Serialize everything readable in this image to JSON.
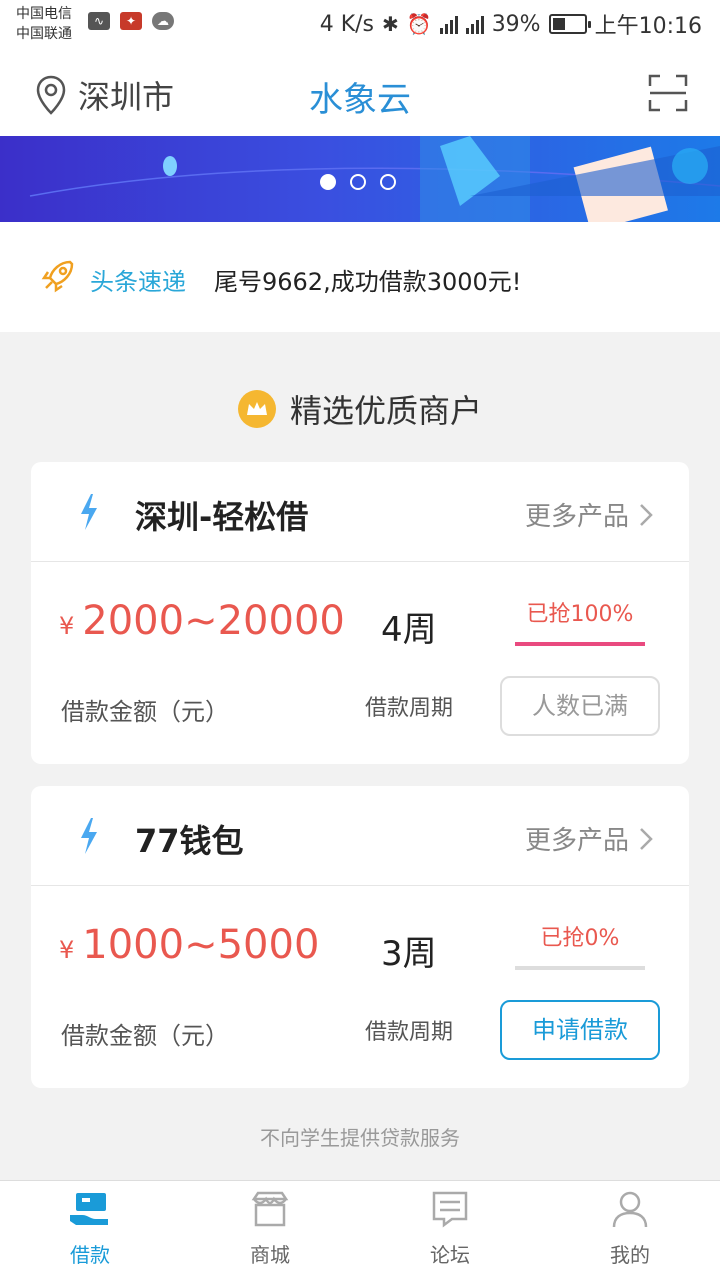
{
  "status_bar": {
    "carrier1": "中国电信",
    "carrier2": "中国联通",
    "speed": "4 K/s",
    "net1": "2G",
    "net2": "4G",
    "battery": "39%",
    "time": "上午10:16"
  },
  "header": {
    "city": "深圳市",
    "title": "水象云"
  },
  "banner": {
    "dots": 3,
    "active_dot": 0
  },
  "news": {
    "tag": "头条速递",
    "message": "尾号9662,成功借款3000元!"
  },
  "section": {
    "title": "精选优质商户"
  },
  "merchants": [
    {
      "name": "深圳-轻松借",
      "more": "更多产品",
      "currency": "¥",
      "amount": "2000~20000",
      "amount_label": "借款金额（元）",
      "period": "4周",
      "period_label": "借款周期",
      "grab": "已抢100%",
      "grab_fraction": 1.0,
      "button": "人数已满",
      "button_enabled": false
    },
    {
      "name": "77钱包",
      "more": "更多产品",
      "currency": "¥",
      "amount": "1000~5000",
      "amount_label": "借款金额（元）",
      "period": "3周",
      "period_label": "借款周期",
      "grab": "已抢0%",
      "grab_fraction": 0.0,
      "button": "申请借款",
      "button_enabled": true
    }
  ],
  "footnote": "不向学生提供贷款服务",
  "tabs": [
    {
      "label": "借款",
      "icon": "loan-icon",
      "active": true
    },
    {
      "label": "商城",
      "icon": "store-icon",
      "active": false
    },
    {
      "label": "论坛",
      "icon": "forum-icon",
      "active": false
    },
    {
      "label": "我的",
      "icon": "profile-icon",
      "active": false
    }
  ],
  "colors": {
    "accent": "#1a9bd8",
    "title_blue": "#2a8fd6",
    "amount_red": "#e9584f",
    "grab_bar_full": "#e94a7f",
    "grab_bar_empty": "#dddddd"
  }
}
